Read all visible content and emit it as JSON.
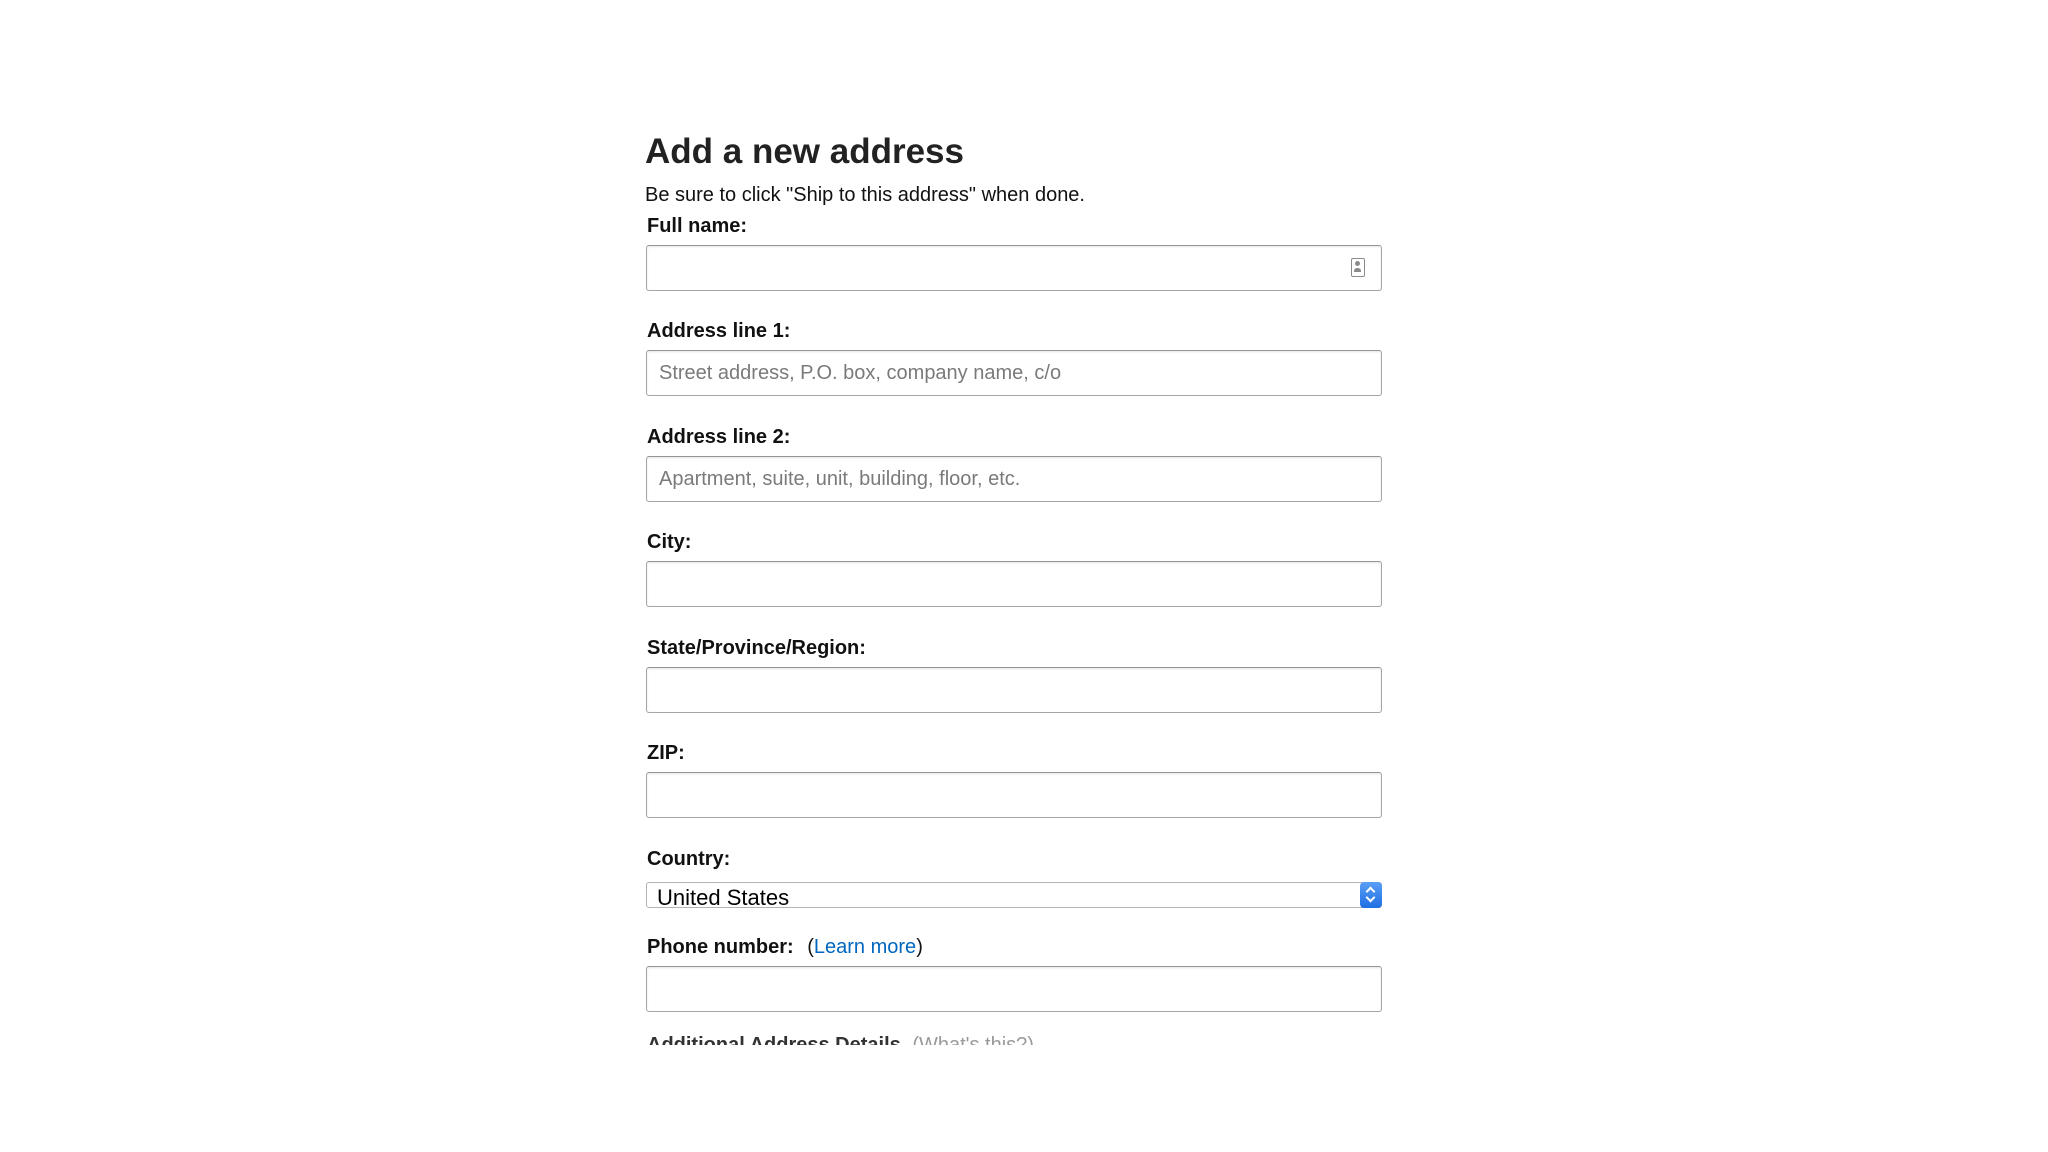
{
  "form": {
    "title": "Add a new address",
    "subtitle": "Be sure to click \"Ship to this address\" when done.",
    "full_name": {
      "label": "Full name:",
      "value": ""
    },
    "address_line_1": {
      "label": "Address line 1:",
      "placeholder": "Street address, P.O. box, company name, c/o",
      "value": ""
    },
    "address_line_2": {
      "label": "Address line 2:",
      "placeholder": "Apartment, suite, unit, building, floor, etc.",
      "value": ""
    },
    "city": {
      "label": "City:",
      "value": ""
    },
    "state": {
      "label": "State/Province/Region:",
      "value": ""
    },
    "zip": {
      "label": "ZIP:",
      "value": ""
    },
    "country": {
      "label": "Country:",
      "selected": "United States"
    },
    "phone": {
      "label": "Phone number:",
      "paren_open": "(",
      "link": "Learn more",
      "paren_close": ")",
      "value": ""
    },
    "additional": {
      "label": "Additional Address Details",
      "hint": "(What's this?)"
    }
  },
  "icons": {
    "full_name_field": "contact-card-icon",
    "country_select": "chevron-up-down-icon"
  },
  "colors": {
    "link": "#0066c0",
    "select_arrow": "#2f7ff0",
    "field_border": "#a6a6a6",
    "placeholder": "#7a7a7a"
  }
}
